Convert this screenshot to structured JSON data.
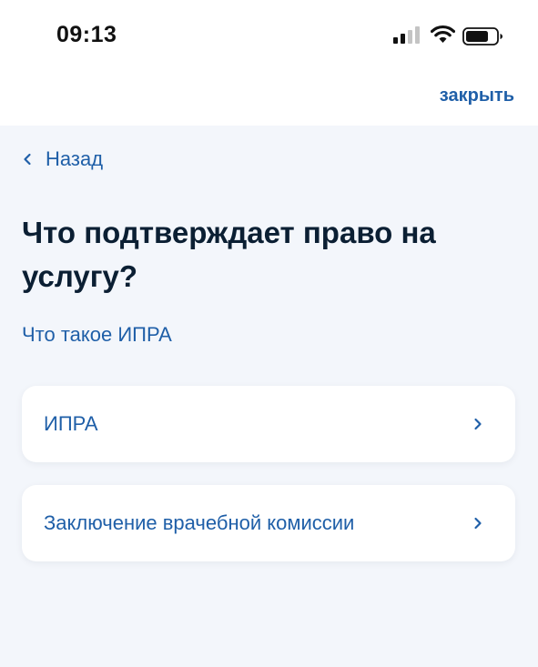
{
  "status_bar": {
    "time": "09:13",
    "icons": [
      "cellular-signal-icon",
      "wifi-icon",
      "battery-icon"
    ]
  },
  "header": {
    "close_label": "закрыть"
  },
  "navigation": {
    "back_label": "Назад",
    "back_icon": "chevron-left-icon"
  },
  "main": {
    "title": "Что подтверждает право на услугу?",
    "info_link": "Что такое ИПРА",
    "options": [
      {
        "label": "ИПРА",
        "icon": "chevron-right-icon"
      },
      {
        "label": "Заключение врачебной комиссии",
        "icon": "chevron-right-icon"
      }
    ]
  },
  "colors": {
    "accent": "#1f5fa8",
    "title": "#0b1f33",
    "background": "#f3f6fb",
    "card": "#ffffff"
  }
}
